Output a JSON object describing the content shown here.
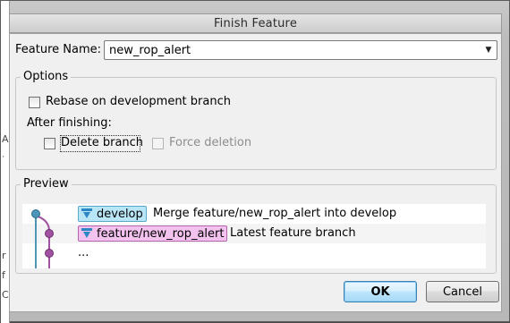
{
  "window": {
    "title": "Finish Feature"
  },
  "feature_name": {
    "label": "Feature Name:",
    "value": "new_rop_alert"
  },
  "options": {
    "title": "Options",
    "rebase_label": "Rebase on development branch",
    "rebase_checked": false,
    "after_label": "After finishing:",
    "delete_branch_label": "Delete branch",
    "delete_branch_checked": false,
    "force_deletion_label": "Force deletion",
    "force_deletion_checked": false
  },
  "preview": {
    "title": "Preview",
    "rows": [
      {
        "branch": "develop",
        "message": "Merge feature/new_rop_alert into develop"
      },
      {
        "branch": "feature/new_rop_alert",
        "message": "Latest feature branch"
      },
      {
        "branch": "",
        "message": "..."
      }
    ]
  },
  "buttons": {
    "ok": "OK",
    "cancel": "Cancel"
  },
  "colors": {
    "develop_line": "#4e95b8",
    "feature_line": "#a052a0",
    "develop_tag_bg": "#b9e6f7",
    "feature_tag_bg": "#f3c2ee"
  }
}
